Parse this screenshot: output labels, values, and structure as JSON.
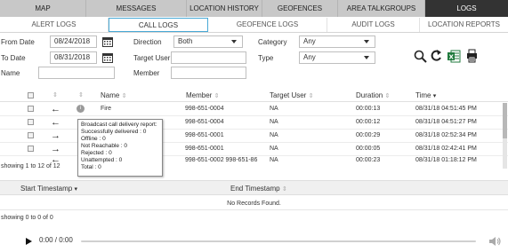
{
  "topnav": [
    {
      "label": "MAP",
      "active": false
    },
    {
      "label": "MESSAGES",
      "active": false
    },
    {
      "label": "LOCATION HISTORY",
      "active": false
    },
    {
      "label": "GEOFENCES",
      "active": false
    },
    {
      "label": "AREA TALKGROUPS",
      "active": false
    },
    {
      "label": "LOGS",
      "active": true
    }
  ],
  "subnav": [
    {
      "label": "ALERT LOGS",
      "active": false
    },
    {
      "label": "CALL LOGS",
      "active": true
    },
    {
      "label": "GEOFENCE LOGS",
      "active": false
    },
    {
      "label": "AUDIT LOGS",
      "active": false
    },
    {
      "label": "LOCATION REPORTS",
      "active": false
    }
  ],
  "filters": {
    "from_date_label": "From Date",
    "from_date_value": "08/24/2018",
    "to_date_label": "To Date",
    "to_date_value": "08/31/2018",
    "name_label": "Name",
    "name_value": "",
    "direction_label": "Direction",
    "direction_value": "Both",
    "target_user_label": "Target User",
    "target_user_value": "",
    "member_label": "Member",
    "member_value": "",
    "category_label": "Category",
    "category_value": "Any",
    "type_label": "Type",
    "type_value": "Any"
  },
  "toolbar_icons": [
    "search-icon",
    "reset-icon",
    "excel-export-icon",
    "print-icon"
  ],
  "call_table": {
    "headers": {
      "name": "Name",
      "member": "Member",
      "target_user": "Target User",
      "duration": "Duration",
      "time": "Time"
    },
    "rows": [
      {
        "direction": "←",
        "name": "Fire",
        "member": "998-651-0004",
        "target": "NA",
        "duration": "00:00:13",
        "time": "08/31/18 04:51:45 PM"
      },
      {
        "direction": "←",
        "name": "",
        "member": "998-651-0004",
        "target": "NA",
        "duration": "00:00:12",
        "time": "08/31/18 04:51:27 PM"
      },
      {
        "direction": "→",
        "name": "",
        "member": "998-651-0001",
        "target": "NA",
        "duration": "00:00:29",
        "time": "08/31/18 02:52:34 PM"
      },
      {
        "direction": "→",
        "name": "",
        "member": "998-651-0001",
        "target": "NA",
        "duration": "00:00:05",
        "time": "08/31/18 02:42:41 PM"
      },
      {
        "direction": "←",
        "name": "",
        "member": "998-651-0002 998-651-86",
        "target": "NA",
        "duration": "00:00:23",
        "time": "08/31/18 01:18:12 PM"
      }
    ],
    "showing": "showing 1 to 12 of 12"
  },
  "tooltip": {
    "lines": [
      "Broadcast call delivery report:",
      "Successfully delivered : 0",
      "Offline : 0",
      "Not Reachable : 0",
      "Rejected : 0",
      "Unattempted : 0",
      "Total : 0"
    ]
  },
  "detail_table": {
    "start_header": "Start Timestamp",
    "end_header": "End Timestamp",
    "no_records": "No Records Found.",
    "showing": "showing 0 to 0 of 0"
  },
  "player": {
    "time": "0:00 / 0:00"
  },
  "colors": {
    "active_tab_bg": "#333333",
    "topnav_bg": "#c8c8c8",
    "active_subtab_border": "#49a9d6",
    "excel_green": "#1f7a3c"
  }
}
